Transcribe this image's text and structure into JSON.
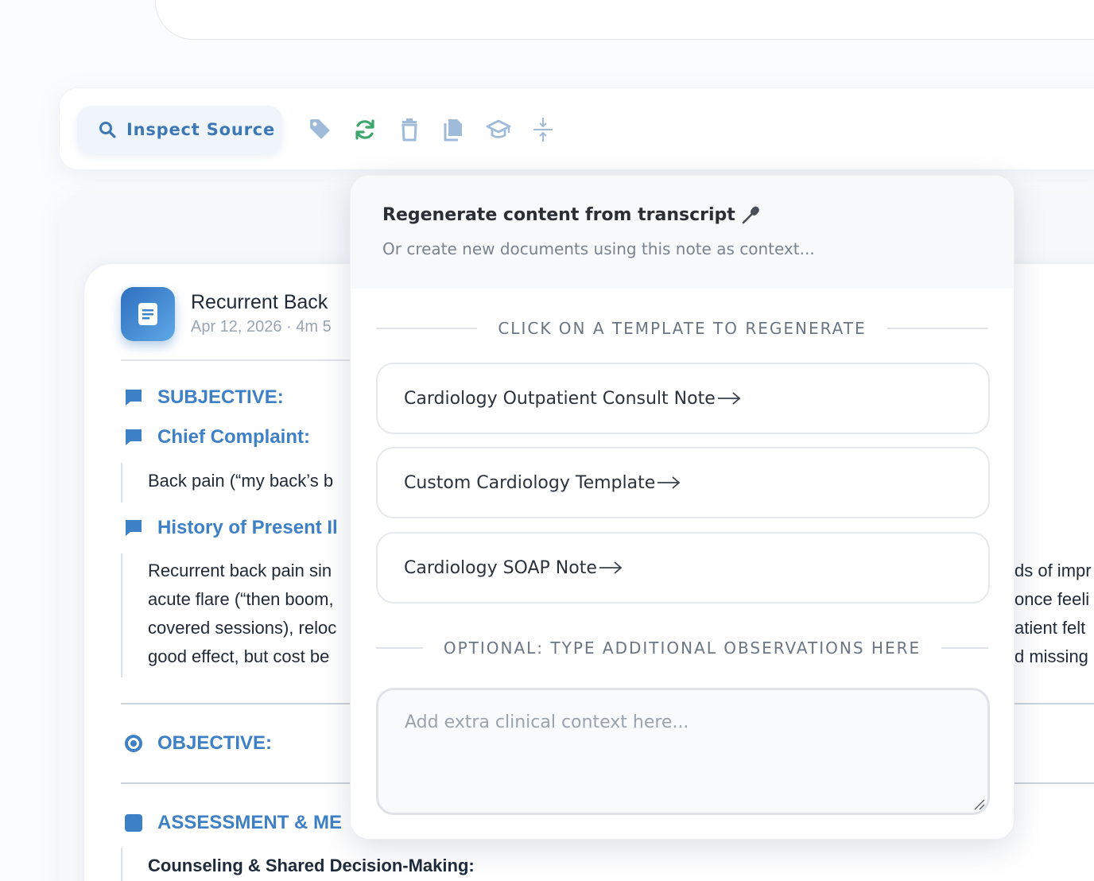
{
  "toolbar": {
    "inspect_label": "Inspect Source",
    "icons": [
      "tag-icon",
      "refresh-icon",
      "trash-icon",
      "copy-icon",
      "graduation-cap-icon",
      "collapse-icon"
    ],
    "accent": "#3d78b5",
    "refresh_color": "#3aa66a"
  },
  "note": {
    "title": "Recurrent Back",
    "meta": "Apr 12, 2026 · 4m 5",
    "sections": {
      "subjective": "SUBJECTIVE:",
      "chief_complaint": "Chief Complaint:",
      "chief_complaint_text": "Back pain (“my back’s b",
      "hpi": "History of Present Il",
      "hpi_lines": [
        "Recurrent back pain sin",
        "acute flare (“then boom,",
        "covered sessions), reloc",
        "good effect, but cost be"
      ],
      "hpi_lines_right": [
        "ds of impr",
        "once feeli",
        "atient felt",
        "d missing"
      ],
      "objective": "OBJECTIVE:",
      "assessment": "ASSESSMENT & ME",
      "counseling": "Counseling & Shared Decision-Making:"
    },
    "heading_color": "#3e80c6"
  },
  "popover": {
    "title": "Regenerate content from transcript",
    "subtitle": "Or create new documents using this note as context...",
    "templates_label": "CLICK ON A TEMPLATE TO REGENERATE",
    "templates": [
      "Cardiology Outpatient Consult Note",
      "Custom Cardiology Template",
      "Cardiology SOAP Note"
    ],
    "optional_label": "OPTIONAL: TYPE ADDITIONAL OBSERVATIONS HERE",
    "textarea_placeholder": "Add extra clinical context here..."
  }
}
